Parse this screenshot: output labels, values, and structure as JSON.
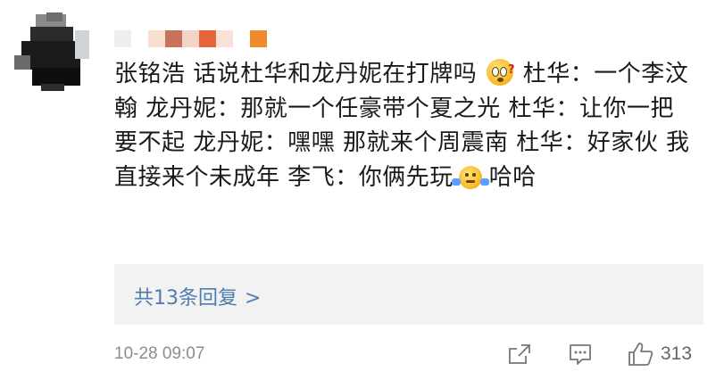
{
  "comment": {
    "segments": [
      "张铭浩 话说杜华和龙丹妮在打牌吗 ",
      " 杜华：一个李汶翰 龙丹妮：那就一个任豪带个夏之光 杜华：让你一把 要不起 龙丹妮：嘿嘿 那就来个周震南 杜华：好家伙 我直接来个未成年 李飞：你俩先玩",
      "哈哈"
    ],
    "emoji_1": "confused-face-icon",
    "emoji_2": "shrug-person-icon"
  },
  "replies": {
    "label": "共13条回复",
    "chevron": ">"
  },
  "footer": {
    "timestamp": "10-28 09:07",
    "like_count": "313"
  },
  "colors": {
    "link": "#507daf",
    "text": "#1a1a1a",
    "meta": "#8c8c8c",
    "reply_bg": "#f2f2f2"
  }
}
